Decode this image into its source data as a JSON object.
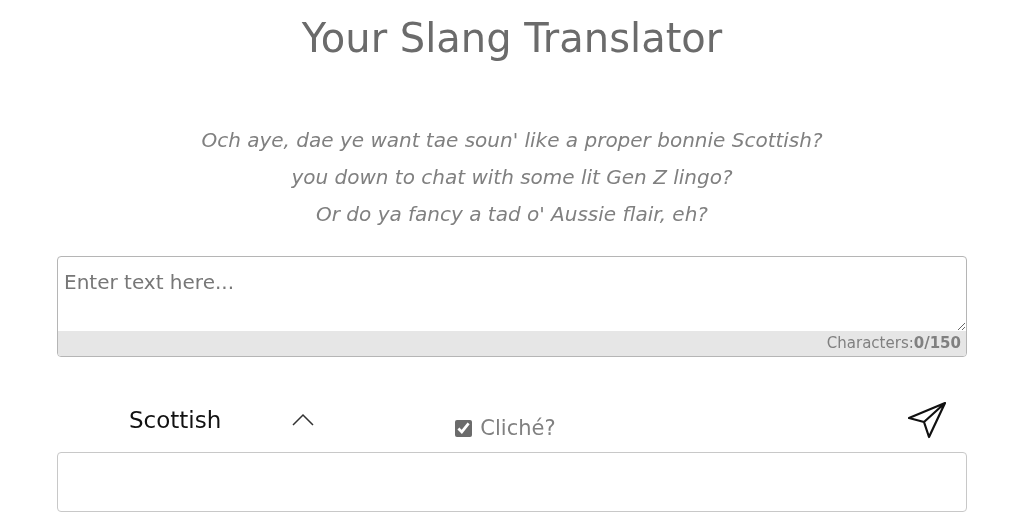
{
  "title": "Your Slang Translator",
  "subtitle_lines": [
    "Och aye, dae ye want tae soun' like a proper bonnie Scottish?",
    "you down to chat with some lit Gen Z lingo?",
    "Or do ya fancy a tad o' Aussie flair, eh?"
  ],
  "input": {
    "placeholder": "Enter text here...",
    "counter": "Characters:**0/150**"
  },
  "dialect_select": {
    "value": "Scottish"
  },
  "cliche": {
    "label": "Cliché?",
    "checked": true
  }
}
